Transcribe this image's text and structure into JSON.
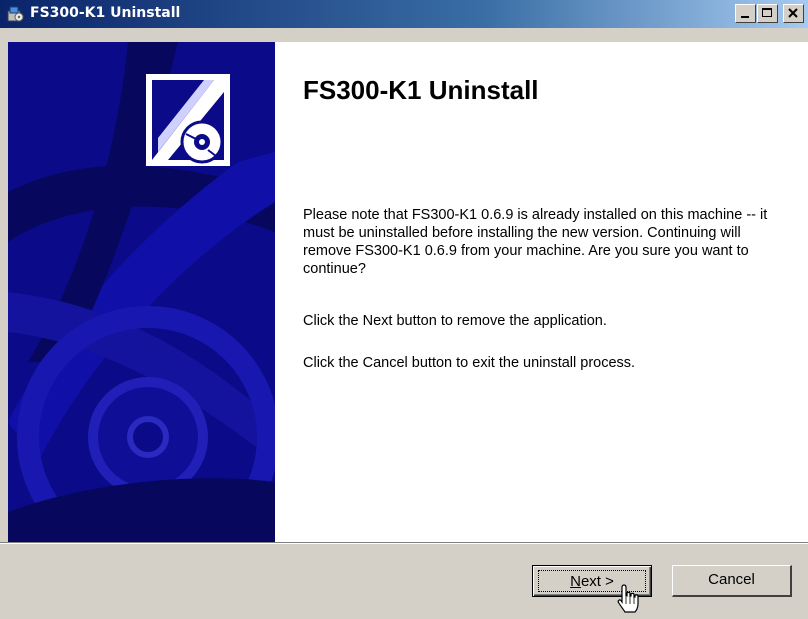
{
  "window": {
    "title": "FS300-K1 Uninstall",
    "icon": "installer-icon",
    "controls": [
      "minimize-icon",
      "maximize-icon",
      "close-icon"
    ]
  },
  "banner": {
    "logo": "installer-logo-icon",
    "background_color": "#0b0b8a"
  },
  "content": {
    "heading": "FS300-K1 Uninstall",
    "paragraph1": "Please note that FS300-K1 0.6.9 is already installed on this machine -- it must be uninstalled before installing the new version. Continuing will remove FS300-K1 0.6.9 from your machine. Are you sure you want to continue?",
    "paragraph2": "Click the Next button to remove the application.",
    "paragraph3": "Click the Cancel button to exit the uninstall process."
  },
  "buttons": {
    "next_mnemonic": "N",
    "next_rest": "ext >",
    "cancel_label": "Cancel"
  },
  "colors": {
    "titlebar_start": "#0a246a",
    "titlebar_end": "#a6caf0",
    "dialog_face": "#d4d0c8"
  }
}
